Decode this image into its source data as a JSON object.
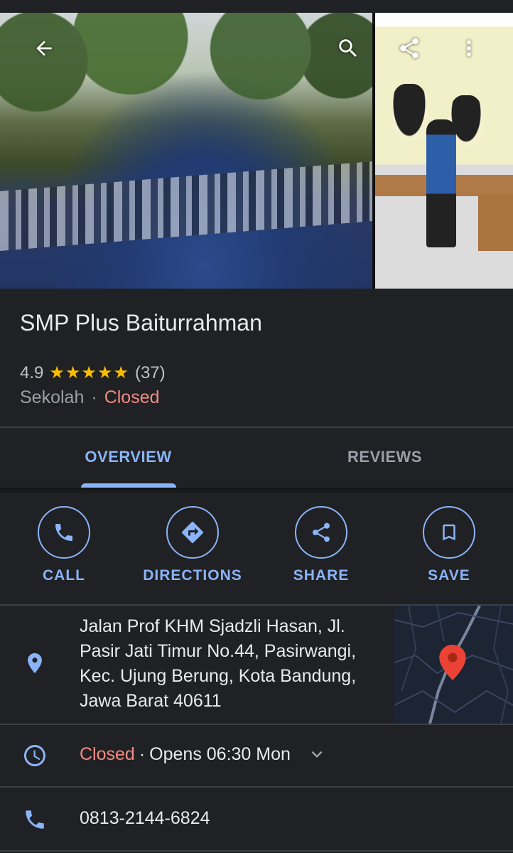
{
  "place": {
    "name": "SMP Plus Baiturrahman",
    "rating": "4.9",
    "stars": "★★★★★",
    "review_count": "(37)",
    "category": "Sekolah",
    "separator": "·",
    "status": "Closed"
  },
  "tabs": [
    {
      "label": "OVERVIEW",
      "active": true
    },
    {
      "label": "REVIEWS",
      "active": false
    }
  ],
  "actions": [
    {
      "label": "CALL",
      "icon": "phone-icon"
    },
    {
      "label": "DIRECTIONS",
      "icon": "directions-icon"
    },
    {
      "label": "SHARE",
      "icon": "share-icon"
    },
    {
      "label": "SAVE",
      "icon": "bookmark-icon"
    }
  ],
  "address": {
    "text": "Jalan Prof KHM Sjadzli Hasan, Jl. Pasir Jati Timur No.44, Pasirwangi, Kec. Ujung Berung, Kota Bandung, Jawa Barat 40611"
  },
  "hours": {
    "status": "Closed",
    "separator": "·",
    "opens": "Opens 06:30 Mon"
  },
  "phone": {
    "number": "0813-2144-6824"
  },
  "colors": {
    "accent": "#8ab4f8",
    "closed": "#f28b82",
    "star": "#fbbc04",
    "background": "#202124"
  }
}
